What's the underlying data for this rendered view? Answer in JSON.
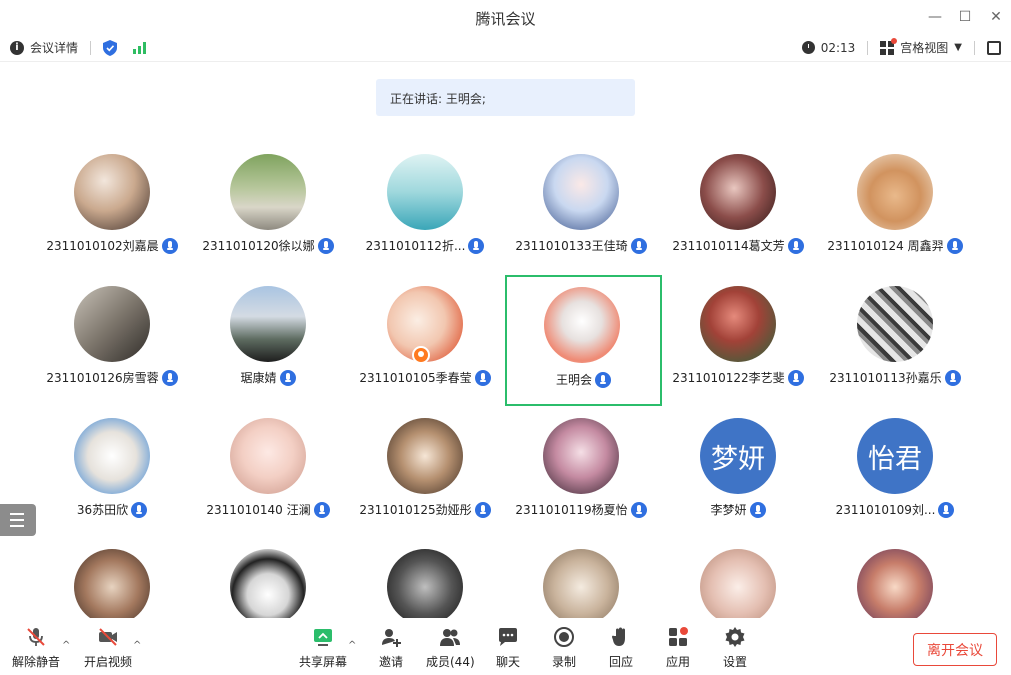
{
  "window": {
    "title": "腾讯会议"
  },
  "infobar": {
    "meeting_details": "会议详情",
    "timer": "02:13",
    "view_mode": "宫格视图"
  },
  "speaking": {
    "text": "正在讲话: 王明会;"
  },
  "participants": [
    {
      "name": "2311010102刘嘉晨"
    },
    {
      "name": "2311010120徐以娜"
    },
    {
      "name": "2311010112折..."
    },
    {
      "name": "2311010133王佳琦"
    },
    {
      "name": "2311010114葛文芳"
    },
    {
      "name": "2311010124 周鑫羿"
    },
    {
      "name": "2311010126房雪蓉"
    },
    {
      "name": "琚康婧"
    },
    {
      "name": "2311010105季春莹"
    },
    {
      "name": "王明会"
    },
    {
      "name": "2311010122李艺斐"
    },
    {
      "name": "2311010113孙嘉乐"
    },
    {
      "name": "36苏田欣"
    },
    {
      "name": "2311010140 汪澜"
    },
    {
      "name": "2311010125劲娅彤"
    },
    {
      "name": "2311010119杨夏怡"
    },
    {
      "name": "李梦妍",
      "avatar_text": "梦妍"
    },
    {
      "name": "2311010109刘...",
      "avatar_text": "怡君"
    }
  ],
  "toolbar": {
    "unmute": "解除静音",
    "start_video": "开启视频",
    "share_screen": "共享屏幕",
    "invite": "邀请",
    "members": "成员(44)",
    "chat": "聊天",
    "record": "录制",
    "react": "回应",
    "apps": "应用",
    "settings": "设置",
    "leave": "离开会议"
  },
  "colors": {
    "accent_blue": "#2f6fe0",
    "active_border": "#2bbd6b",
    "leave_red": "#e9493a",
    "speaking_bg": "#e8f0fd"
  }
}
